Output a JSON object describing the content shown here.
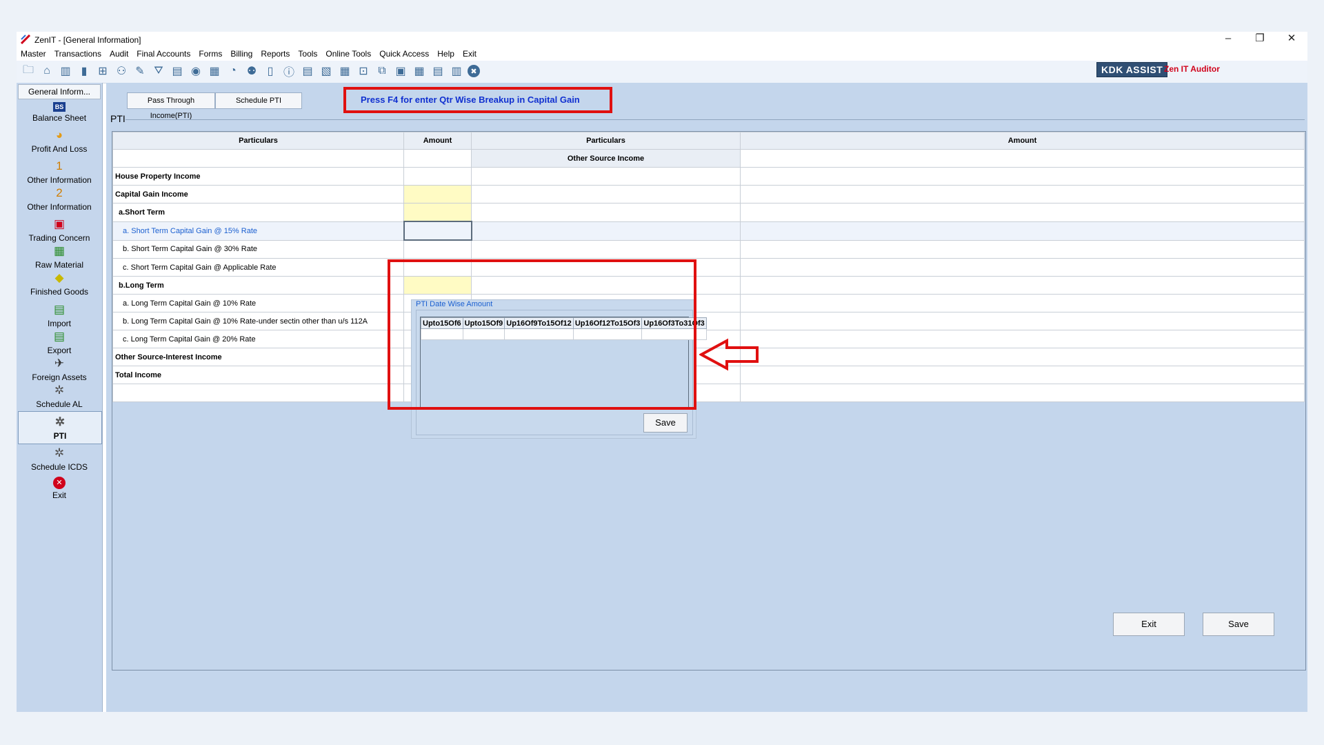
{
  "window": {
    "title": "ZenIT - [General Information]",
    "minimize": "–",
    "restore": "❐",
    "close": "✕"
  },
  "menu": [
    "Master",
    "Transactions",
    "Audit",
    "Final Accounts",
    "Forms",
    "Billing",
    "Reports",
    "Tools",
    "Online Tools",
    "Quick Access",
    "Help",
    "Exit"
  ],
  "toolbar": {
    "icons": [
      "open-icon",
      "home-icon",
      "buildings-icon",
      "bar-chart-icon",
      "gift-icon",
      "users-icon",
      "tools-icon",
      "filter-icon",
      "tax-icon",
      "refresh-icon",
      "calculator-icon",
      "pie-chart-icon",
      "user-icon",
      "book-icon",
      "info-icon",
      "report-icon",
      "document-icon",
      "calendar-icon",
      "inbox-icon",
      "copy-icon",
      "balance-sheet-icon",
      "building-icon",
      "sco-icon",
      "form-icon",
      "close-circle-icon"
    ],
    "brand": "KDK ASSIST",
    "product": "Zen IT Auditor"
  },
  "sidebar": {
    "header": "General Inform...",
    "items": [
      {
        "label": "Balance Sheet",
        "icon": "balance-sheet-icon",
        "glyph": "BS"
      },
      {
        "label": "Profit And Loss",
        "icon": "profit-loss-icon",
        "glyph": "◕"
      },
      {
        "label": "Other Information",
        "icon": "number-one-icon",
        "glyph": "1"
      },
      {
        "label": "Other Information",
        "icon": "number-two-icon",
        "glyph": "2"
      },
      {
        "label": "Trading Concern",
        "icon": "trading-concern-icon",
        "glyph": "▣"
      },
      {
        "label": "Raw Material",
        "icon": "raw-material-icon",
        "glyph": "▦"
      },
      {
        "label": "Finished Goods",
        "icon": "finished-goods-icon",
        "glyph": "◆"
      },
      {
        "label": "Import",
        "icon": "import-icon",
        "glyph": "▤"
      },
      {
        "label": "Export",
        "icon": "export-icon",
        "glyph": "▤"
      },
      {
        "label": "Foreign Assets",
        "icon": "foreign-assets-icon",
        "glyph": "✈"
      },
      {
        "label": "Schedule AL",
        "icon": "schedule-al-icon",
        "glyph": "✲"
      },
      {
        "label": "PTI",
        "icon": "pti-icon",
        "glyph": "✲"
      },
      {
        "label": "Schedule ICDS",
        "icon": "schedule-icds-icon",
        "glyph": "✲"
      },
      {
        "label": "Exit",
        "icon": "exit-icon",
        "glyph": "✕"
      }
    ]
  },
  "tabs": [
    "Pass Through Income(PTI)",
    "Schedule PTI"
  ],
  "f4_message": "Press F4 for enter Qtr Wise Breakup in Capital Gain",
  "section_label": "PTI",
  "grid": {
    "headers": [
      "Particulars",
      "Amount",
      "Particulars",
      "Amount"
    ],
    "sub_header": "Other Source Income",
    "rows": [
      "House Property Income",
      "Capital Gain Income",
      "a.Short Term",
      "a. Short Term Capital Gain @ 15% Rate",
      "b. Short Term Capital Gain @ 30% Rate",
      "c. Short Term Capital Gain @ Applicable Rate",
      "b.Long Term",
      "a. Long Term Capital Gain @ 10% Rate",
      "b. Long Term Capital Gain @ 10% Rate-under sectin other than u/s 112A",
      "c. Long Term Capital Gain @ 20% Rate",
      "Other Source-Interest Income",
      "Total Income"
    ]
  },
  "popup": {
    "title": "PTI Date Wise Amount",
    "columns": [
      "Upto15Of6",
      "Upto15Of9",
      "Up16Of9To15Of12",
      "Up16Of12To15Of3",
      "Up16Of3To31Of3"
    ],
    "save": "Save"
  },
  "buttons": {
    "exit": "Exit",
    "save": "Save"
  },
  "colors": {
    "highlight_red": "#e01010",
    "message_blue": "#1030d0",
    "yellow_cell": "#fffbc4",
    "panel_blue": "#c4d6ec"
  }
}
